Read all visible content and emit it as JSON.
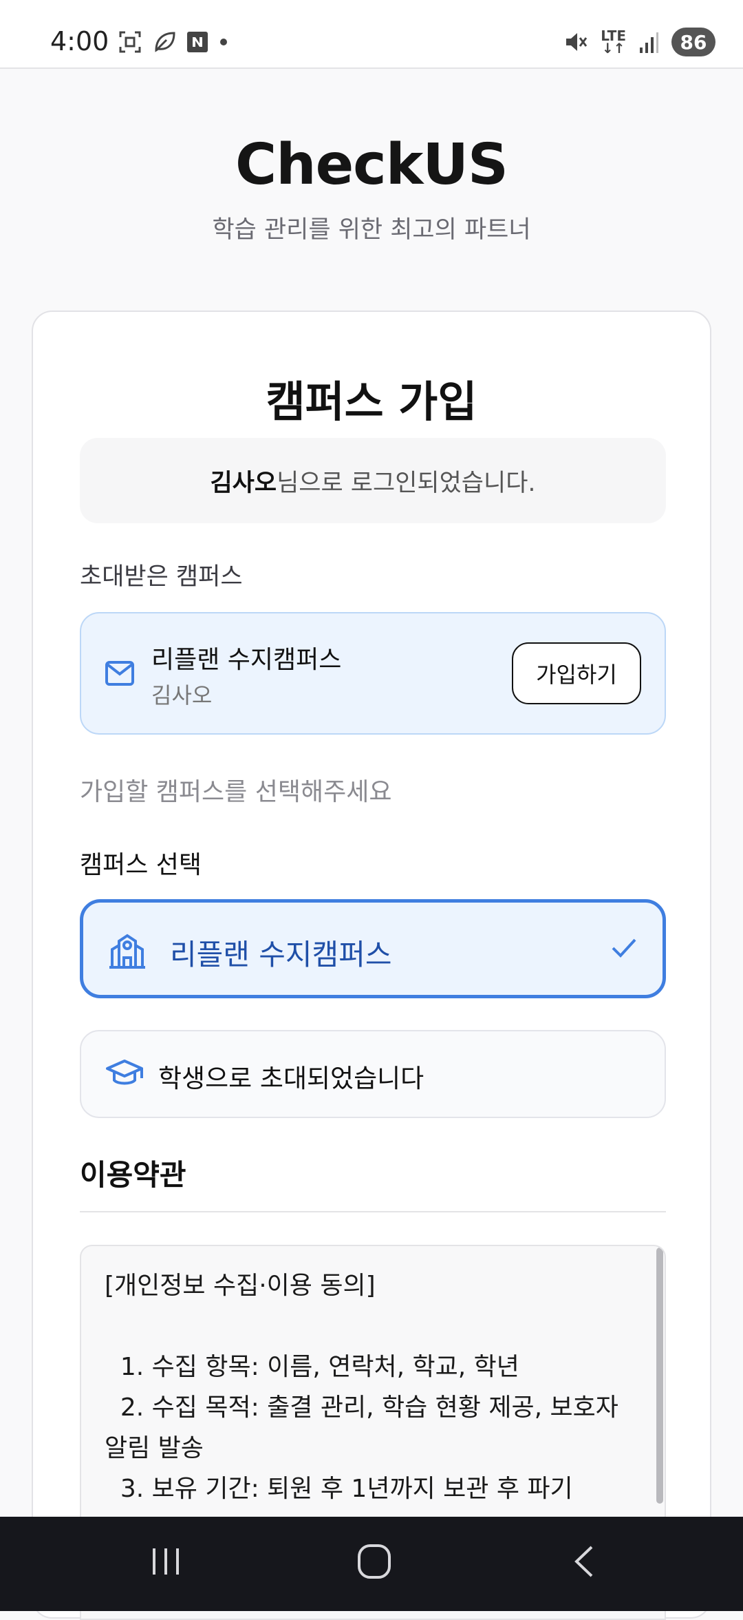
{
  "status_bar": {
    "time": "4:00",
    "network": "LTE",
    "battery": "86"
  },
  "header": {
    "title": "CheckUS",
    "tagline": "학습 관리를 위한 최고의 파트너"
  },
  "card": {
    "title": "캠퍼스 가입",
    "login_name": "김사오",
    "login_suffix": "님으로 로그인되었습니다.",
    "invited_label": "초대받은 캠퍼스",
    "invite": {
      "campus": "리플랜 수지캠퍼스",
      "inviter": "김사오",
      "join_button": "가입하기"
    },
    "hint": "가입할 캠퍼스를 선택해주세요",
    "select_label": "캠퍼스 선택",
    "selected_campus": "리플랜 수지캠퍼스",
    "role_text": "학생으로 초대되었습니다",
    "terms_title": "이용약관",
    "terms_body": "[개인정보 수집·이용 동의]\n\n  1. 수집 항목: 이름, 연락처, 학교, 학년\n  2. 수집 목적: 출결 관리, 학습 현황 제공, 보호자 알림 발송\n  3. 보유 기간: 퇴원 후 1년까지 보관 후 파기"
  },
  "colors": {
    "accent": "#3f7ee0",
    "selected_text": "#1f4fa8",
    "invite_bg": "#ecf4fe"
  }
}
